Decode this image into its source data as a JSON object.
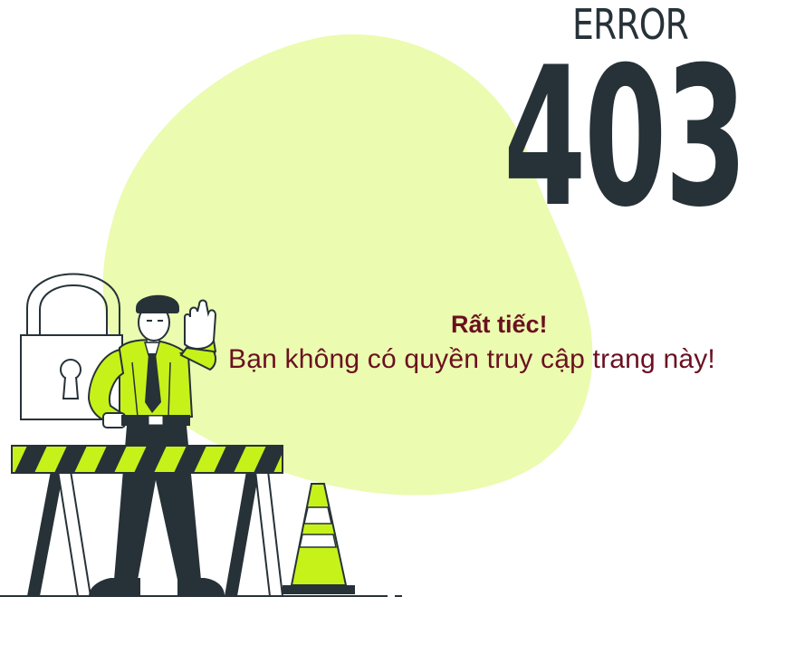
{
  "error_page": {
    "label": "ERROR",
    "code": "403",
    "title": "Rất tiếc!",
    "message": "Bạn không có quyền truy cập trang này!"
  },
  "colors": {
    "blob": "#ebfbb0",
    "dark": "#263238",
    "accent_green": "#c6f21a",
    "message": "#6b1020"
  },
  "icons": {
    "padlock": "lock-icon",
    "guard": "security-guard",
    "barrier": "road-barrier",
    "cone": "traffic-cone"
  }
}
